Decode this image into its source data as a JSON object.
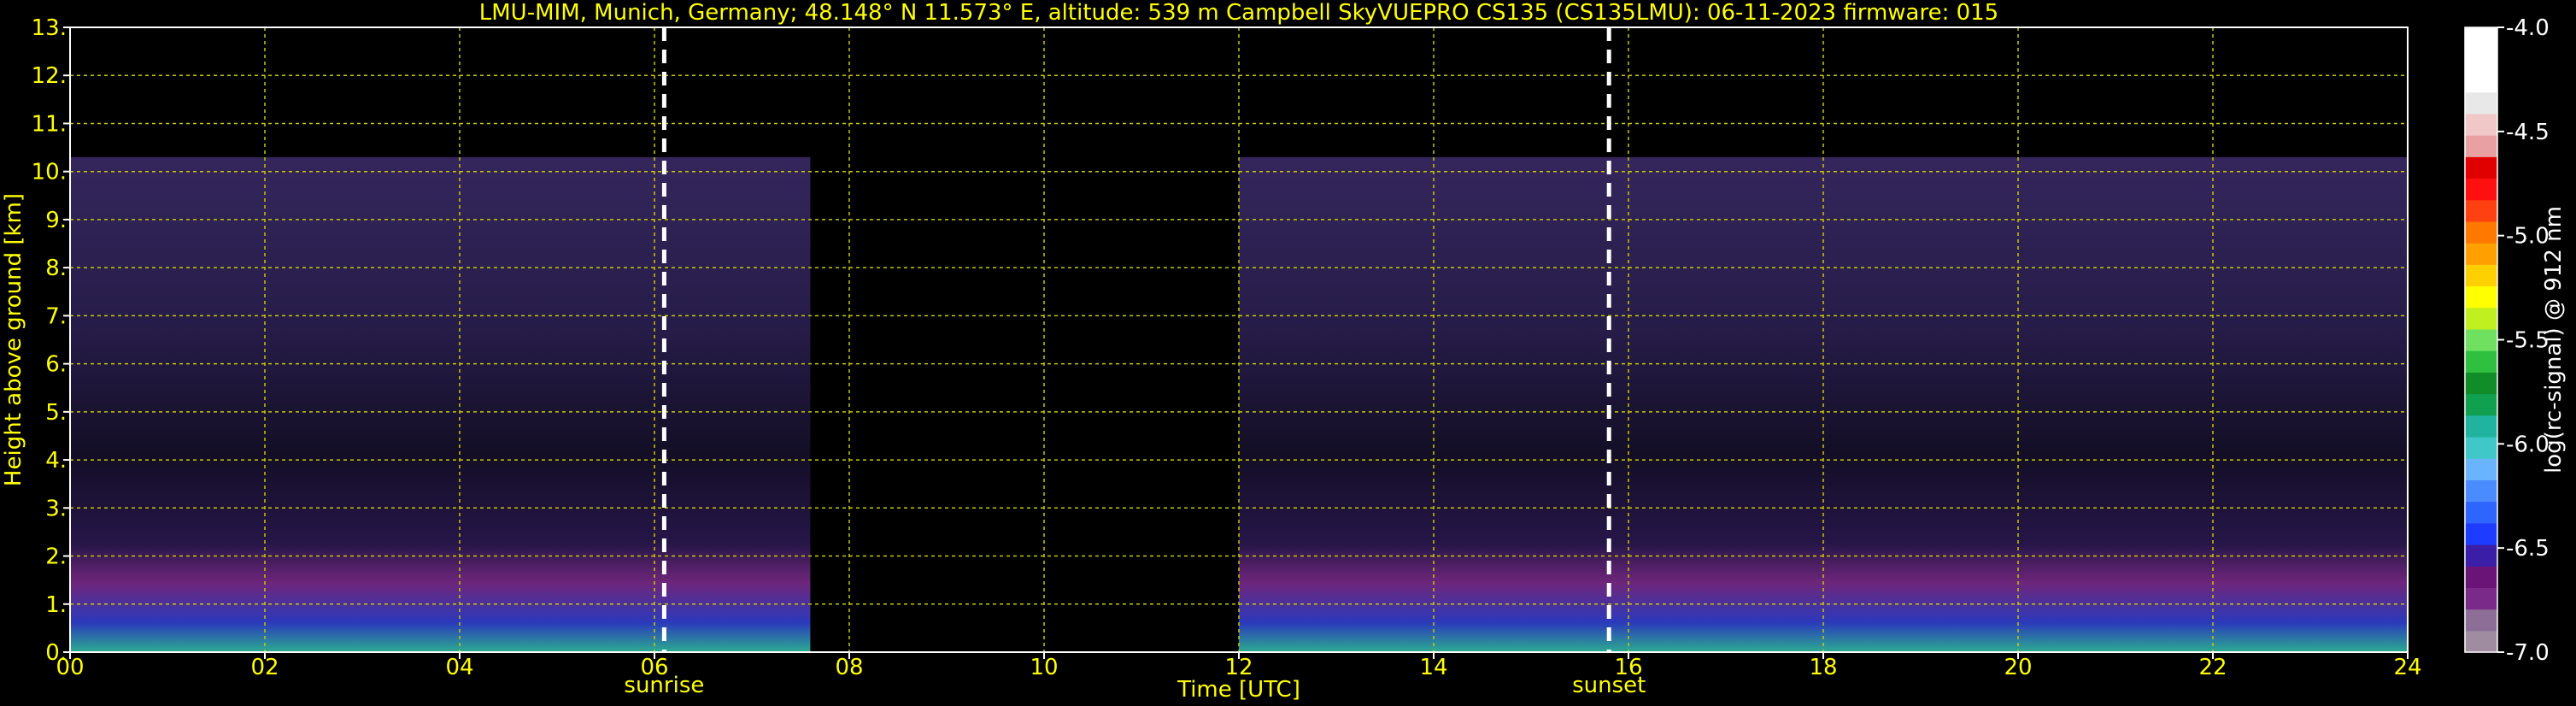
{
  "chart_data": {
    "type": "heatmap",
    "title": "LMU-MIM, Munich, Germany; 48.148° N 11.573° E, altitude: 539 m    Campbell SkyVUEPRO CS135 (CS135LMU): 06-11-2023    firmware: 015",
    "xlabel": "Time [UTC]",
    "ylabel": "Height above ground [km]",
    "xlim": [
      0,
      24
    ],
    "ylim": [
      0,
      13
    ],
    "x_ticks": [
      0,
      2,
      4,
      6,
      8,
      10,
      12,
      14,
      16,
      18,
      20,
      22,
      24
    ],
    "x_tick_labels": [
      "00",
      "02",
      "04",
      "06",
      "08",
      "10",
      "12",
      "14",
      "16",
      "18",
      "20",
      "22",
      "24"
    ],
    "y_ticks": [
      0,
      1,
      2,
      3,
      4,
      5,
      6,
      7,
      8,
      9,
      10,
      11,
      12,
      13
    ],
    "y_tick_labels": [
      "0.",
      "1.",
      "2.",
      "3.",
      "4.",
      "5.",
      "6.",
      "7.",
      "8.",
      "9.",
      "10.",
      "11.",
      "12.",
      "13."
    ],
    "grid": true,
    "markers": [
      {
        "label": "sunrise",
        "x": 6.1
      },
      {
        "label": "sunset",
        "x": 15.8
      }
    ],
    "data_coverage": [
      {
        "start": 0.0,
        "end": 7.6,
        "top_km": 10.3
      },
      {
        "start": 12.0,
        "end": 24.0,
        "top_km": 10.3
      }
    ],
    "colorbar": {
      "label": "log(rc-signal) @ 912 nm",
      "min": -7.0,
      "max": -4.0,
      "ticks": [
        -4.0,
        -4.5,
        -5.0,
        -5.5,
        -6.0,
        -6.5,
        -7.0
      ],
      "tick_labels": [
        "-4.0",
        "-4.5",
        "-5.0",
        "-5.5",
        "-6.0",
        "-6.5",
        "-7.0"
      ],
      "colors": [
        "#a08ca0",
        "#8c6e96",
        "#7a2a88",
        "#6a1478",
        "#3a1ea8",
        "#1e3cff",
        "#2e64ff",
        "#4a8cff",
        "#6ab4ff",
        "#40c8c8",
        "#20b4a0",
        "#10a050",
        "#108c28",
        "#30c040",
        "#70e060",
        "#c0f020",
        "#ffff00",
        "#ffd000",
        "#ffa000",
        "#ff7800",
        "#ff4010",
        "#ff1010",
        "#e00000",
        "#e8a0a0",
        "#f0c8c8",
        "#e8e8e8",
        "#ffffff",
        "#ffffff",
        "#ffffff"
      ]
    }
  }
}
